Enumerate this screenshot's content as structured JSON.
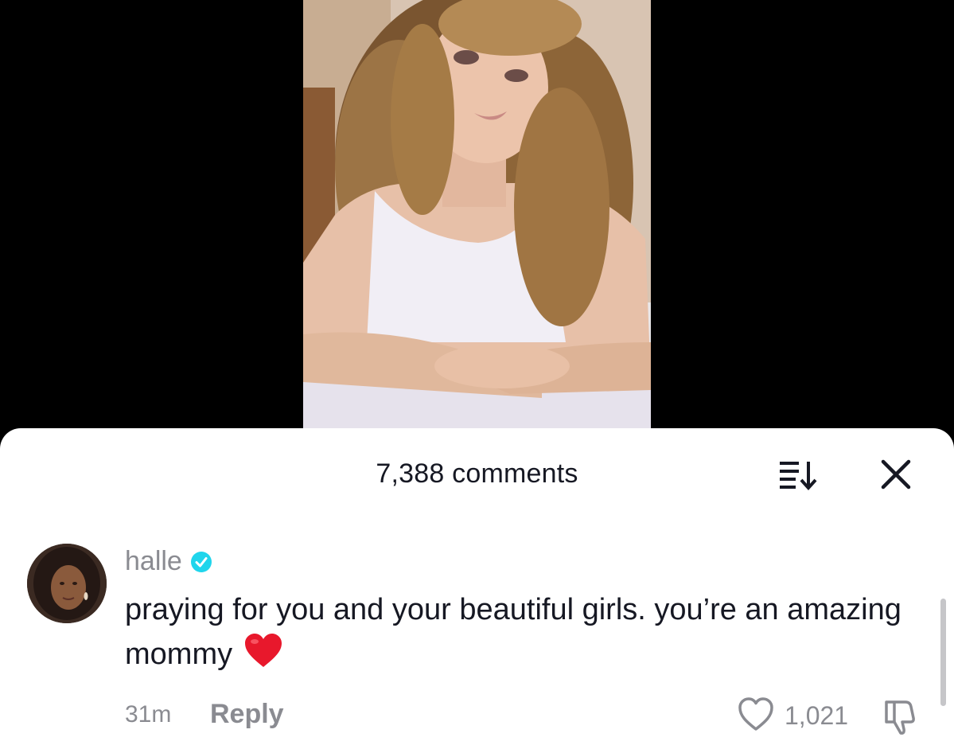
{
  "video": {
    "description_icon": "video-frame"
  },
  "comments_sheet": {
    "title": "7,388 comments",
    "sort_icon": "sort-icon",
    "close_icon": "close-icon"
  },
  "comment": {
    "username": "halle",
    "verified_icon": "verified-badge-icon",
    "text": "praying for you and your beautiful girls. you’re an amazing mommy",
    "emoji": "❤️",
    "time": "31m",
    "reply_label": "Reply",
    "like_count": "1,021",
    "like_icon": "heart-outline-icon",
    "dislike_icon": "dislike-icon"
  },
  "colors": {
    "primary_text": "#161823",
    "secondary_text": "#8a8b91",
    "verified_blue": "#20d5ec",
    "heart_red": "#e8182c"
  }
}
